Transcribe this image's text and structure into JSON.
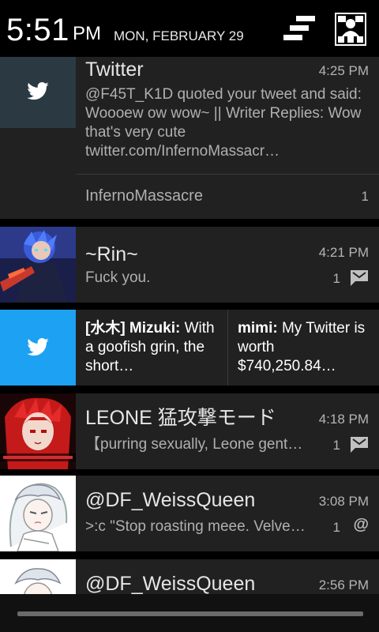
{
  "status_bar": {
    "time": "5:51",
    "ampm": "PM",
    "date": "MON, FEBRUARY 29"
  },
  "notifications": [
    {
      "app_icon": "twitter-bird-icon",
      "title": "Twitter",
      "time": "4:25 PM",
      "body": "@F45T_K1D quoted your tweet and said: Woooew ow wow~ || Writer Replies: Wow that's very cute twitter.com/InfernoMassacr…",
      "footer_account": "InfernoMassacre",
      "footer_count": "1"
    },
    {
      "avatar": "avatar-anime-blue-hair",
      "title": "~Rin~",
      "time": "4:21 PM",
      "body": "Fuck you.",
      "count": "1",
      "type_icon": "message-icon"
    },
    {
      "app_icon": "twitter-bird-icon",
      "col1_sender": "[水木] Mizuki:",
      "col1_text": "With a goofish grin, the short…",
      "col2_sender": "mimi:",
      "col2_text": "My Twitter is worth $740,250.84…"
    },
    {
      "avatar": "avatar-anime-red-hair",
      "title": "LEONE 猛攻撃モード",
      "time": "4:18 PM",
      "body": "【purring sexually, Leone gent…",
      "count": "1",
      "type_icon": "message-icon"
    },
    {
      "avatar": "avatar-anime-white-hair",
      "title": "@DF_WeissQueen",
      "time": "3:08 PM",
      "body": ">:c \"Stop roasting meee. Velve…",
      "count": "1",
      "type_icon": "mention-icon"
    },
    {
      "avatar": "avatar-anime-white-hair",
      "title": "@DF_WeissQueen",
      "time": "2:56 PM"
    }
  ],
  "colors": {
    "card_bg": "#212121",
    "twitter_blue": "#1da1f2",
    "twitter_dark": "#2b3a42"
  }
}
